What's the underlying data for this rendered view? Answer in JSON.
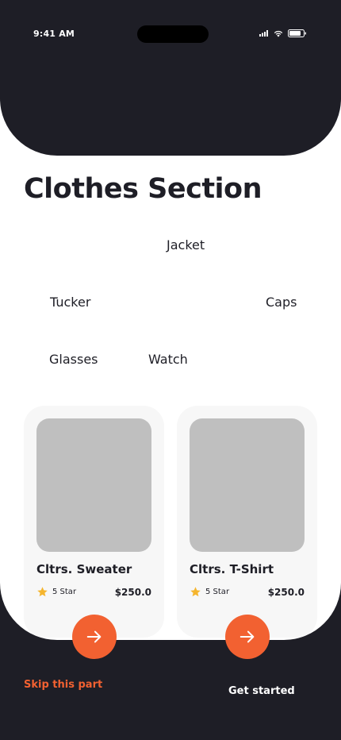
{
  "status_bar": {
    "time": "9:41 AM"
  },
  "page": {
    "title": "Clothes Section"
  },
  "categories": [
    "Jacket",
    "Tucker",
    "Caps",
    "Glasses",
    "Watch"
  ],
  "products": [
    {
      "name": "Cltrs. Sweater",
      "rating": "5 Star",
      "price": "$250.0"
    },
    {
      "name": "Cltrs. T-Shirt",
      "rating": "5 Star",
      "price": "$250.0"
    }
  ],
  "footer": {
    "skip_label": "Skip this part",
    "get_started_label": "Get started"
  },
  "colors": {
    "accent": "#f26131",
    "dark": "#1e1e26",
    "star": "#f5b52e",
    "placeholder": "#bfbfbf"
  }
}
